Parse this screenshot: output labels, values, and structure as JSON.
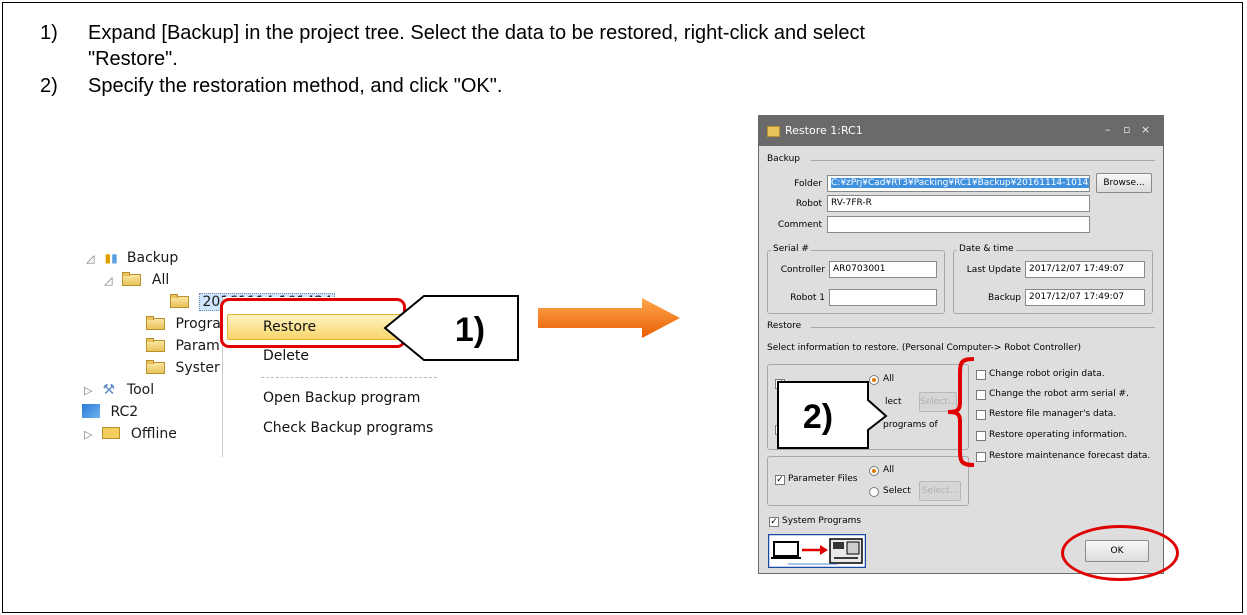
{
  "instructions": [
    {
      "num": "1)",
      "line1": "Expand [Backup] in the project tree. Select the data to be restored, right-click and select",
      "line2": "\"Restore\"."
    },
    {
      "num": "2)",
      "line1": "Specify the restoration method, and click \"OK\"."
    }
  ],
  "tree": {
    "backup": "Backup",
    "all": "All",
    "entry": "20161114-101424",
    "programs": "Progra",
    "params": "Param",
    "system": "Syster",
    "tool": "Tool",
    "rc2": "RC2",
    "offline": "Offline"
  },
  "context_menu": {
    "restore": "Restore",
    "delete": "Delete",
    "open_backup": "Open Backup program",
    "check_backup": "Check Backup programs"
  },
  "callouts": {
    "step1": "1)",
    "step2": "2)"
  },
  "colors": {
    "accent_red": "#e00000",
    "arrow_orange": "#f07a10"
  },
  "dialog": {
    "title": "Restore 1:RC1",
    "title_controls": [
      "–",
      "▫",
      "×"
    ],
    "backup_section": "Backup",
    "folder_label": "Folder",
    "folder_value": "C:¥zPrj¥Cad¥RT3¥Packing¥RC1¥Backup¥20161114-101424",
    "browse": "Browse...",
    "robot_label": "Robot",
    "robot_value": "RV-7FR-R",
    "comment_label": "Comment",
    "comment_value": "",
    "serial_group": "Serial #",
    "controller_label": "Controller",
    "controller_value": "AR0703001",
    "robot1_label": "Robot 1",
    "robot1_value": "",
    "datetime_group": "Date & time",
    "last_update_label": "Last Update",
    "last_update_value": "2017/12/07 17:49:07",
    "backup_label": "Backup",
    "backup_value": "2017/12/07 17:49:07",
    "restore_section": "Restore",
    "restore_info": "Select information to restore. (Personal Computer-> Robot Controller)",
    "all_radio": "All",
    "select_radio_partial": "lect",
    "select_button": "Select...",
    "programs_of": "programs of",
    "param_files": "Parameter Files",
    "param_all": "All",
    "param_select": "Select",
    "param_select_button": "Select...",
    "system_programs": "System Programs",
    "options": [
      "Change robot origin data.",
      "Change the robot arm serial #.",
      "Restore file manager's data.",
      "Restore operating information.",
      "Restore maintenance forecast data."
    ],
    "ok": "OK"
  }
}
